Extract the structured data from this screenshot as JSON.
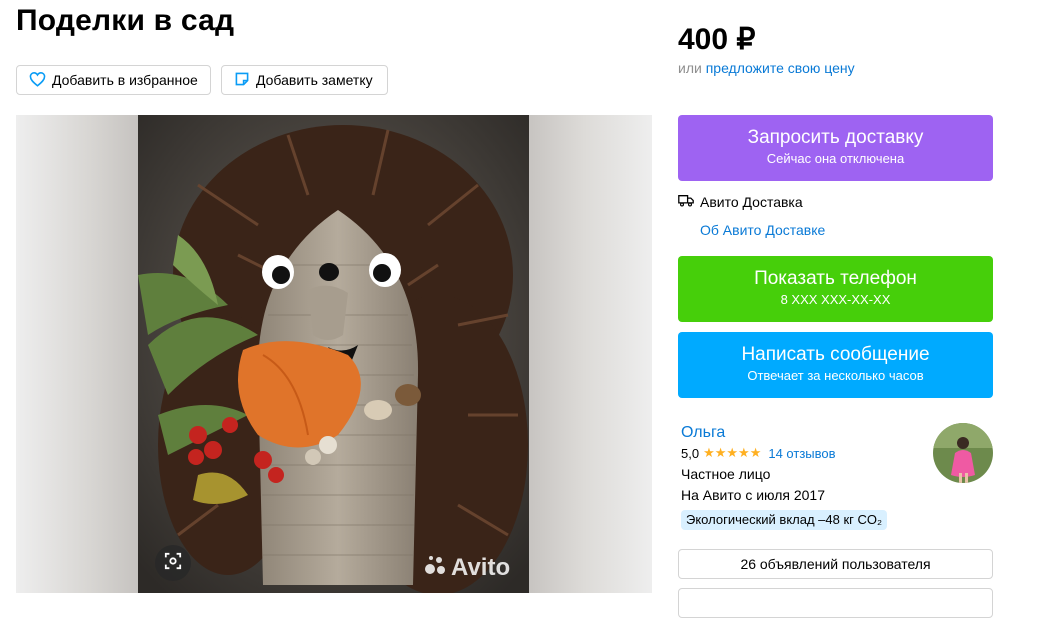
{
  "listing": {
    "title": "Поделки в сад",
    "add_favorite_label": "Добавить в избранное",
    "add_note_label": "Добавить заметку",
    "watermark": "Avito"
  },
  "price": {
    "value": "400 ₽",
    "or_text": "или ",
    "offer_link": "предложите свою цену"
  },
  "actions": {
    "delivery": {
      "label": "Запросить доставку",
      "sub": "Сейчас она отключена"
    },
    "delivery_service": "Авито Доставка",
    "delivery_about_link": "Об Авито Доставке",
    "phone": {
      "label": "Показать телефон",
      "sub": "8 XXX XXX-XX-XX"
    },
    "message": {
      "label": "Написать сообщение",
      "sub": "Отвечает за несколько часов"
    }
  },
  "seller": {
    "name": "Ольга",
    "rating": "5,0",
    "stars": "★★★★★",
    "reviews": "14 отзывов",
    "type": "Частное лицо",
    "since": "На Авито с июля 2017",
    "eco": "Экологический вклад –48 кг CO₂",
    "ads_button": "26 объявлений пользователя"
  },
  "colors": {
    "delivery_button": "#9e63f2",
    "phone_button": "#46cf0a",
    "message_button": "#00aaff",
    "link": "#0a7ad6",
    "star": "#ffb021"
  },
  "icons": [
    "heart-icon",
    "note-icon",
    "truck-icon",
    "zoom-icon",
    "avito-logo-icon"
  ]
}
